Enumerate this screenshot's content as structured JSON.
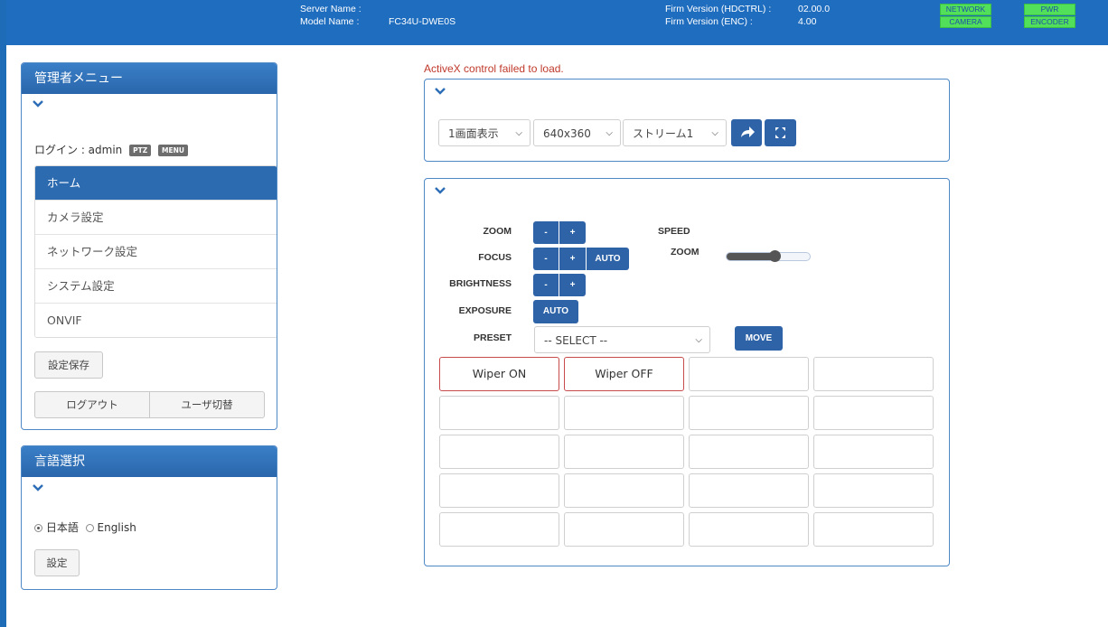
{
  "header": {
    "server_name_label": "Server Name :",
    "model_name_label": "Model Name :",
    "model_name_value": "FC34U-DWE0S",
    "firm_hdctrl_label": "Firm Version (HDCTRL) :",
    "firm_hdctrl_value": "02.00.0",
    "firm_enc_label": "Firm Version (ENC) :",
    "firm_enc_value": "4.00",
    "status": {
      "network": "NETWORK",
      "camera": "CAMERA",
      "pwr": "PWR",
      "encoder": "ENCODER"
    },
    "status_color": "#52e05a",
    "brand_color": "#1f6dbf"
  },
  "admin_menu": {
    "title": "管理者メニュー",
    "login_text": "ログイン : admin",
    "tag_ptz": "PTZ",
    "tag_menu": "MENU",
    "items": [
      {
        "label": "ホーム",
        "active": true
      },
      {
        "label": "カメラ設定"
      },
      {
        "label": "ネットワーク設定"
      },
      {
        "label": "システム設定"
      },
      {
        "label": "ONVIF"
      }
    ],
    "save_button": "設定保存",
    "logout_button": "ログアウト",
    "switch_user_button": "ユーザ切替"
  },
  "language": {
    "title": "言語選択",
    "option_ja": "日本語",
    "option_en": "English",
    "selected": "日本語",
    "set_button": "設定"
  },
  "viewer": {
    "error_text": "ActiveX control failed to load.",
    "layout_select": "1画面表示",
    "resolution_select": "640x360",
    "stream_select": "ストリーム1"
  },
  "ptz": {
    "zoom_label": "ZOOM",
    "focus_label": "FOCUS",
    "brightness_label": "BRIGHTNESS",
    "exposure_label": "EXPOSURE",
    "preset_label": "PRESET",
    "minus": "-",
    "plus": "+",
    "auto": "AUTO",
    "speed_label": "SPEED",
    "speed_zoom_label": "ZOOM",
    "speed_zoom_value": 0.6,
    "preset_select": "-- SELECT --",
    "move_button": "MOVE",
    "grid": [
      "Wiper ON",
      "Wiper OFF",
      "",
      "",
      "",
      "",
      "",
      "",
      "",
      "",
      "",
      "",
      "",
      "",
      "",
      "",
      "",
      "",
      "",
      ""
    ]
  }
}
